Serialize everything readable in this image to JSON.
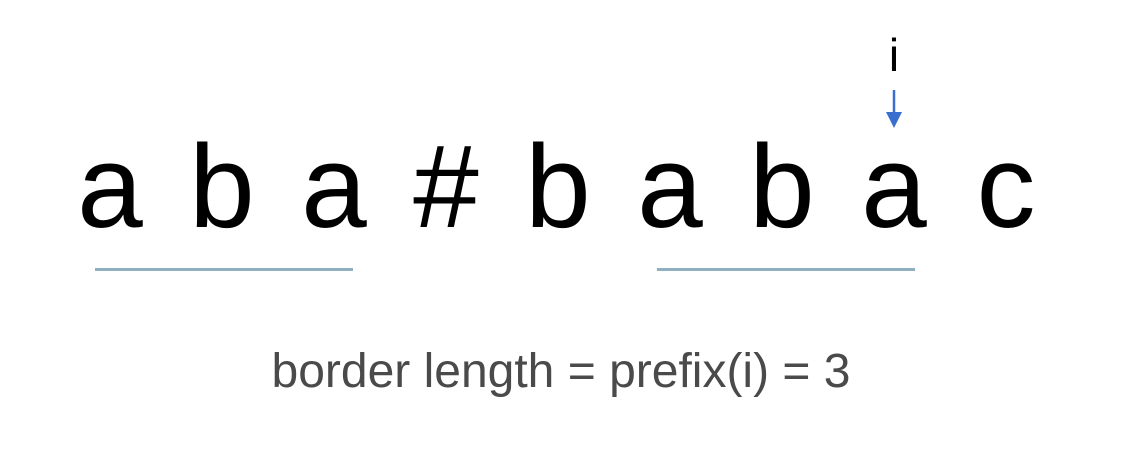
{
  "diagram": {
    "characters": [
      "a",
      "b",
      "a",
      "#",
      "b",
      "a",
      "b",
      "a",
      "c"
    ],
    "pointer_label": "i",
    "pointer_index": 7,
    "caption": "border length = prefix(i) = 3",
    "colors": {
      "text": "#000000",
      "arrow": "#3a6fd0",
      "underline": "#8fb0c0",
      "caption": "#4a4a4a"
    }
  }
}
